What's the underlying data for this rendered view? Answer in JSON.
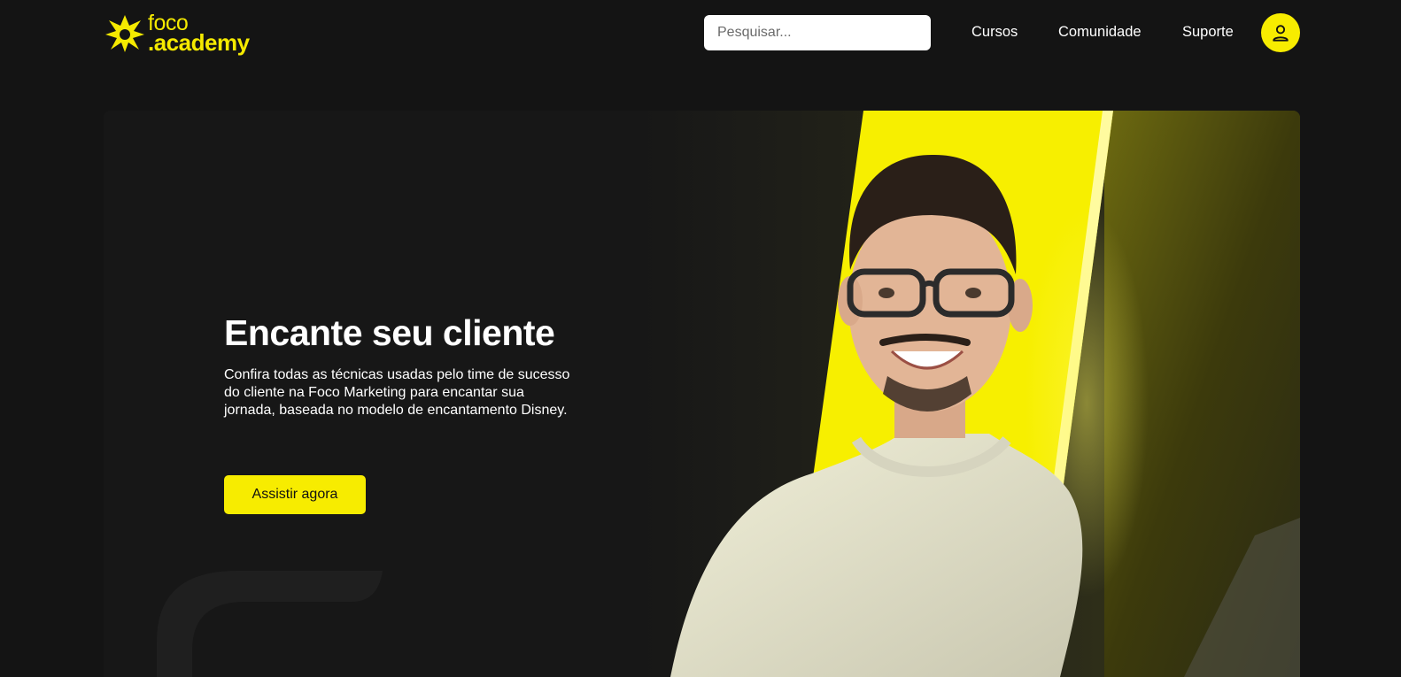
{
  "brand": {
    "name_line1": "foco",
    "name_line2": ".academy",
    "color": "#f5ea00"
  },
  "header": {
    "search_placeholder": "Pesquisar...",
    "nav": {
      "cursos": "Cursos",
      "comunidade": "Comunidade",
      "suporte": "Suporte"
    },
    "avatar_icon": "user-icon"
  },
  "hero": {
    "title": "Encante seu cliente",
    "description": "Confira todas as técnicas usadas pelo time de sucesso do cliente na Foco Marketing para encantar sua jornada, baseada no modelo de encantamento Disney.",
    "cta_label": "Assistir agora",
    "accent_color": "#f7ec00"
  }
}
